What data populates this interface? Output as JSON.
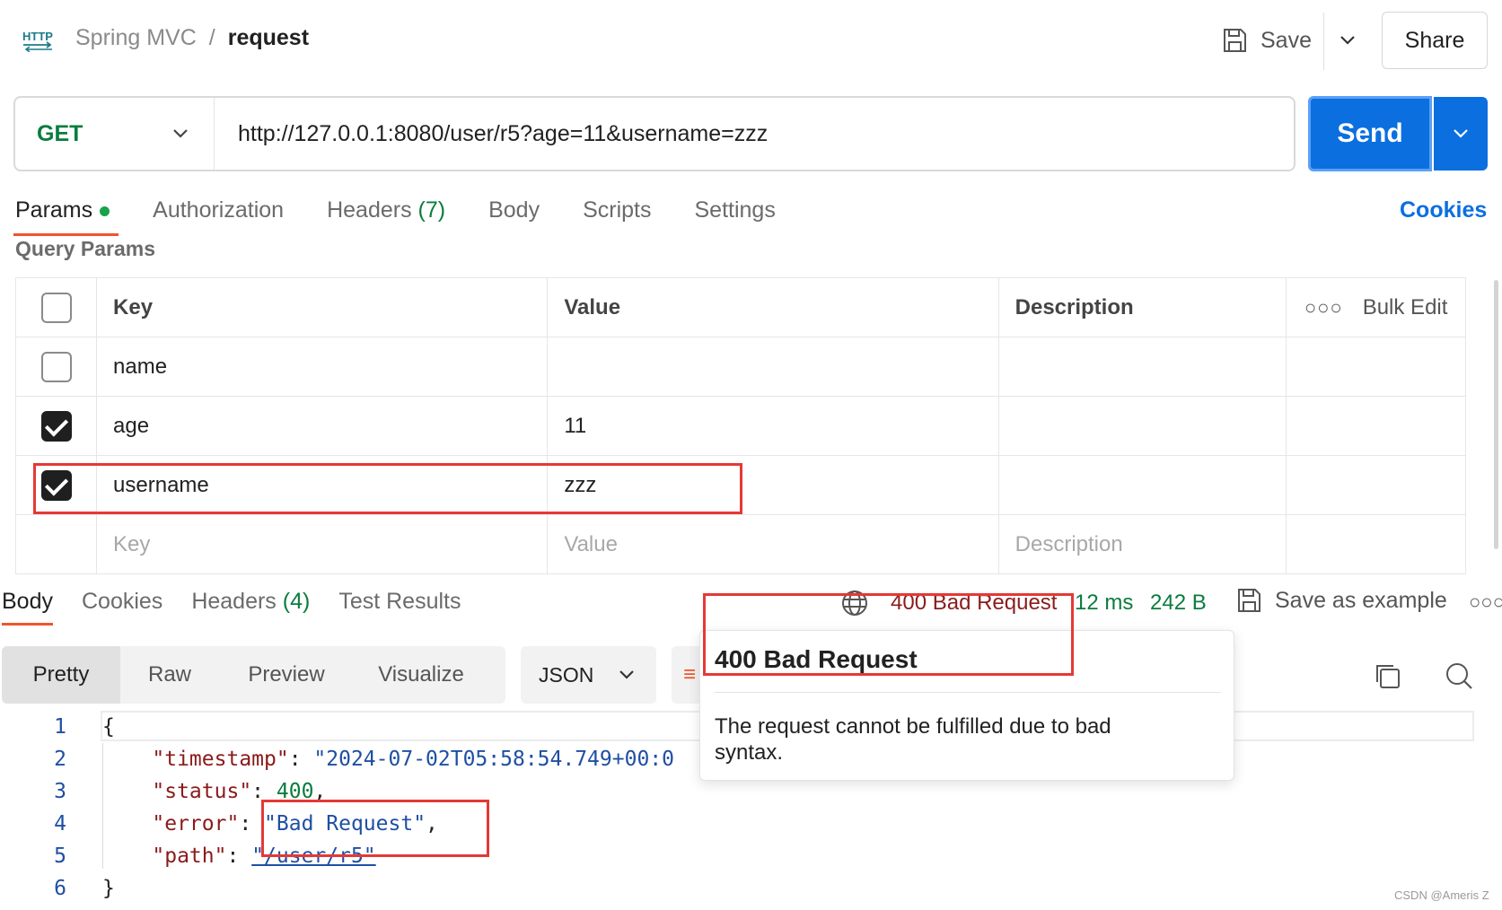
{
  "header": {
    "collection": "Spring MVC",
    "separator": "/",
    "request_name": "request",
    "save_label": "Save",
    "share_label": "Share",
    "http_icon": "http-icon"
  },
  "request": {
    "method": "GET",
    "method_color": "#0b7c3e",
    "url": "http://127.0.0.1:8080/user/r5?age=11&username=zzz",
    "send_label": "Send",
    "send_color": "#0b6fe0"
  },
  "request_tabs": {
    "params": "Params",
    "authorization": "Authorization",
    "headers": "Headers",
    "headers_count": "(7)",
    "body": "Body",
    "scripts": "Scripts",
    "settings": "Settings",
    "cookies": "Cookies"
  },
  "query_params": {
    "title": "Query Params",
    "columns": {
      "key": "Key",
      "value": "Value",
      "description": "Description",
      "bulk_edit": "Bulk Edit"
    },
    "rows": [
      {
        "checked": false,
        "key": "name",
        "value": "",
        "description": ""
      },
      {
        "checked": true,
        "key": "age",
        "value": "11",
        "description": ""
      },
      {
        "checked": true,
        "key": "username",
        "value": "zzz",
        "description": ""
      }
    ],
    "placeholder": {
      "key": "Key",
      "value": "Value",
      "description": "Description"
    }
  },
  "response": {
    "tabs": {
      "body": "Body",
      "cookies": "Cookies",
      "headers": "Headers",
      "headers_count": "(4)",
      "test_results": "Test Results"
    },
    "status": "400 Bad Request",
    "status_color": "#8b1c1c",
    "time": "12 ms",
    "size": "242 B",
    "save_example": "Save as example",
    "view_tabs": [
      "Pretty",
      "Raw",
      "Preview",
      "Visualize"
    ],
    "format": "JSON"
  },
  "code": {
    "line_numbers": [
      "1",
      "2",
      "3",
      "4",
      "5",
      "6"
    ],
    "open_brace": "{",
    "close_brace": "}",
    "timestamp_key": "\"timestamp\"",
    "timestamp_value": "\"2024-07-02T05:58:54.749+00:0",
    "status_key": "\"status\"",
    "status_value": "400",
    "error_key": "\"error\"",
    "error_value": "\"Bad Request\"",
    "path_key": "\"path\"",
    "path_value": "\"/user/r5\""
  },
  "tooltip": {
    "title": "400 Bad Request",
    "description": "The request cannot be fulfilled due to bad syntax."
  },
  "watermark": "CSDN @Ameris Z"
}
